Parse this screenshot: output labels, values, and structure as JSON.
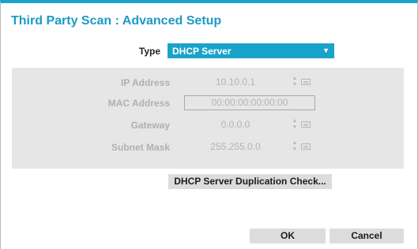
{
  "dialog": {
    "title": "Third Party Scan : Advanced Setup"
  },
  "type": {
    "label": "Type",
    "selected": "DHCP Server",
    "icon": "chevron-down-icon"
  },
  "fields": {
    "ip_address": {
      "label": "IP Address",
      "value": "10.10.0.1"
    },
    "mac_address": {
      "label": "MAC Address",
      "value": "00:00:00:00:00:00"
    },
    "gateway": {
      "label": "Gateway",
      "value": "0.0.0.0"
    },
    "subnet_mask": {
      "label": "Subnet Mask",
      "value": "255.255.0.0"
    }
  },
  "buttons": {
    "duplication_check": "DHCP Server Duplication Check...",
    "ok": "OK",
    "cancel": "Cancel"
  },
  "colors": {
    "accent": "#1aa3c8",
    "panel": "#e6e6e6",
    "disabled_text": "#b0b0b0",
    "button_bg": "#dcdcdc"
  }
}
